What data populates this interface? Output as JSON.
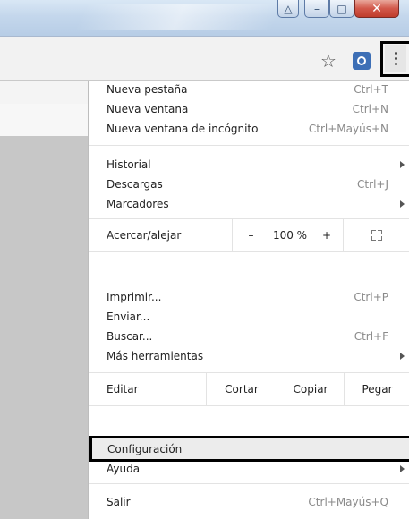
{
  "titlebar": {
    "user_icon": "user-icon",
    "minimize_label": "–",
    "maximize_label": "□",
    "close_label": "✕"
  },
  "toolbar": {
    "bookmark_star": "☆",
    "extension_icon": "extension-icon",
    "menu_icon": "three-dots-menu-icon"
  },
  "menu": {
    "new_tab": {
      "label": "Nueva pestaña",
      "shortcut": "Ctrl+T"
    },
    "new_window": {
      "label": "Nueva ventana",
      "shortcut": "Ctrl+N"
    },
    "incognito": {
      "label": "Nueva ventana de incógnito",
      "shortcut": "Ctrl+Mayús+N"
    },
    "history": {
      "label": "Historial"
    },
    "downloads": {
      "label": "Descargas",
      "shortcut": "Ctrl+J"
    },
    "bookmarks": {
      "label": "Marcadores"
    },
    "zoom": {
      "label": "Acercar/alejar",
      "minus": "–",
      "value": "100 %",
      "plus": "+"
    },
    "print": {
      "label": "Imprimir...",
      "shortcut": "Ctrl+P"
    },
    "send": {
      "label": "Enviar..."
    },
    "find": {
      "label": "Buscar...",
      "shortcut": "Ctrl+F"
    },
    "more_tools": {
      "label": "Más herramientas"
    },
    "edit": {
      "label": "Editar",
      "cut": "Cortar",
      "copy": "Copiar",
      "paste": "Pegar"
    },
    "settings": {
      "label": "Configuración"
    },
    "help": {
      "label": "Ayuda"
    },
    "exit": {
      "label": "Salir",
      "shortcut": "Ctrl+Mayús+Q"
    }
  }
}
